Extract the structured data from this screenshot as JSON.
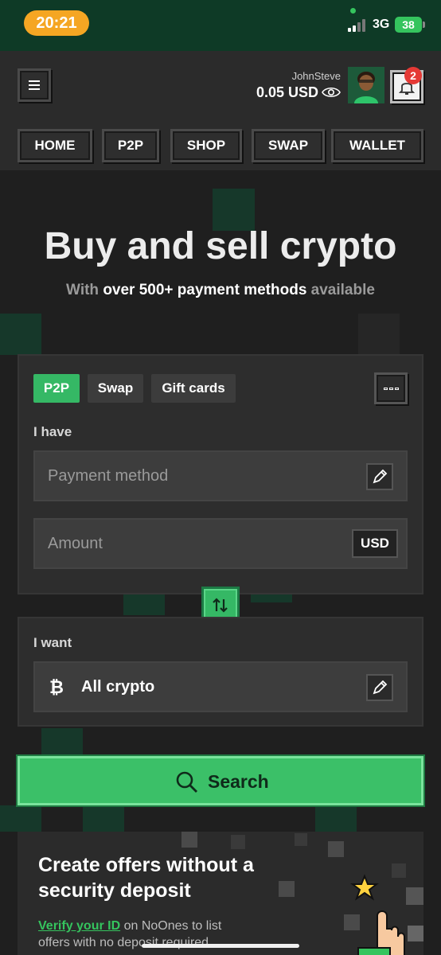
{
  "status_bar": {
    "time": "20:21",
    "network": "3G",
    "battery": "38"
  },
  "header": {
    "username": "JohnSteve",
    "balance": "0.05 USD",
    "notification_count": "2",
    "nav": [
      "HOME",
      "P2P",
      "SHOP",
      "SWAP",
      "WALLET"
    ]
  },
  "hero": {
    "title": "Buy and sell crypto",
    "subtitle_prefix": "With ",
    "subtitle_highlight": "over 500+ payment methods",
    "subtitle_suffix": " available"
  },
  "trade": {
    "tabs": [
      "P2P",
      "Swap",
      "Gift cards"
    ],
    "active_tab": "P2P",
    "i_have_label": "I have",
    "payment_placeholder": "Payment method",
    "amount_placeholder": "Amount",
    "currency": "USD",
    "i_want_label": "I want",
    "crypto_value": "All crypto",
    "search_label": "Search"
  },
  "promo": {
    "title": "Create offers without a security deposit",
    "link_text": "Verify your ID",
    "text": " on NoOnes to list offers with no deposit required"
  },
  "colors": {
    "accent": "#35b865",
    "header_bg": "#0e3a26",
    "page_bg": "#1f1f1f"
  }
}
